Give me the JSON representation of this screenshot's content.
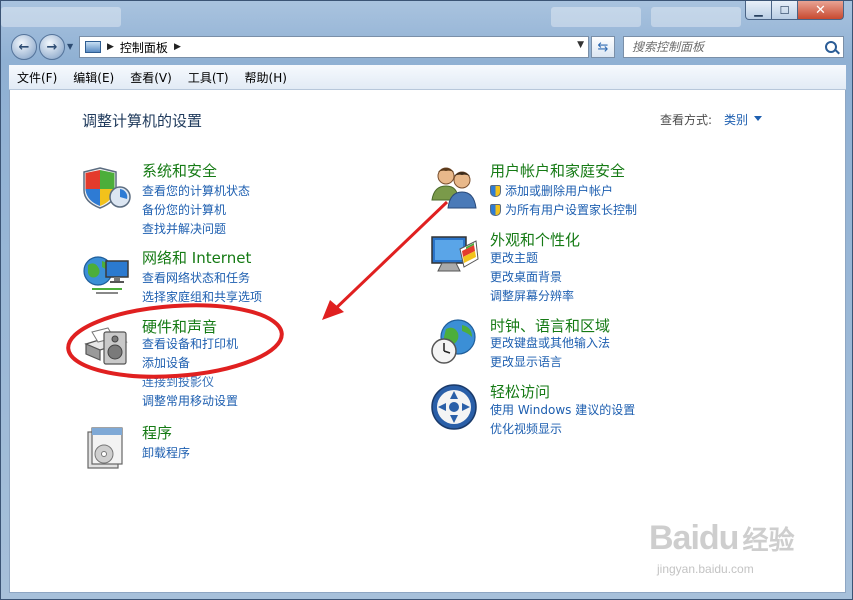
{
  "address": {
    "crumb": "控制面板"
  },
  "search": {
    "placeholder": "搜索控制面板"
  },
  "menu": [
    "文件(F)",
    "编辑(E)",
    "查看(V)",
    "工具(T)",
    "帮助(H)"
  ],
  "page_title": "调整计算机的设置",
  "view": {
    "label": "查看方式:",
    "value": "类别"
  },
  "categories": {
    "system": {
      "title": "系统和安全",
      "links": [
        "查看您的计算机状态",
        "备份您的计算机",
        "查找并解决问题"
      ]
    },
    "network": {
      "title": "网络和 Internet",
      "links": [
        "查看网络状态和任务",
        "选择家庭组和共享选项"
      ]
    },
    "hardware": {
      "title": "硬件和声音",
      "links": [
        "查看设备和打印机",
        "添加设备",
        "连接到投影仪",
        "调整常用移动设置"
      ]
    },
    "programs": {
      "title": "程序",
      "links": [
        "卸载程序"
      ]
    },
    "users": {
      "title": "用户帐户和家庭安全",
      "links": [
        "添加或删除用户帐户",
        "为所有用户设置家长控制"
      ]
    },
    "appearance": {
      "title": "外观和个性化",
      "links": [
        "更改主题",
        "更改桌面背景",
        "调整屏幕分辨率"
      ]
    },
    "clock": {
      "title": "时钟、语言和区域",
      "links": [
        "更改键盘或其他输入法",
        "更改显示语言"
      ]
    },
    "access": {
      "title": "轻松访问",
      "links": [
        "使用 Windows 建议的设置",
        "优化视频显示"
      ]
    }
  },
  "watermark": {
    "brand": "Baidu",
    "cn": "经验",
    "url": "jingyan.baidu.com"
  },
  "colors": {
    "title_green": "#157a14",
    "link_blue": "#1e5fb0",
    "annotation_red": "#e02020"
  }
}
